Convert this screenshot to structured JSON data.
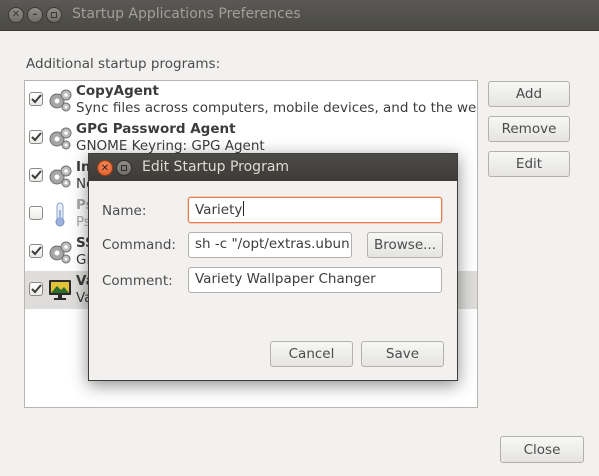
{
  "window": {
    "title": "Startup Applications Preferences",
    "section_label": "Additional startup programs:"
  },
  "programs": [
    {
      "name": "CopyAgent",
      "description": "Sync files across computers, mobile devices, and to the web",
      "checked": true,
      "icon": "gears-icon"
    },
    {
      "name": "GPG Password Agent",
      "description": "GNOME Keyring: GPG Agent",
      "checked": true,
      "icon": "gears-icon"
    },
    {
      "name": "In",
      "description": "No",
      "checked": true,
      "icon": "gears-icon"
    },
    {
      "name": "Ps",
      "description": "Ps",
      "checked": false,
      "icon": "thermometer-icon"
    },
    {
      "name": "SS",
      "description": "GN",
      "checked": true,
      "icon": "gears-icon"
    },
    {
      "name": "Va",
      "description": "Va",
      "checked": true,
      "icon": "monitor-icon"
    }
  ],
  "side_buttons": {
    "add": "Add",
    "remove": "Remove",
    "edit": "Edit"
  },
  "close_button": "Close",
  "dialog": {
    "title": "Edit Startup Program",
    "name_label": "Name:",
    "name_value": "Variety",
    "command_label": "Command:",
    "command_value": "sh -c \"/opt/extras.ubun",
    "browse_label": "Browse...",
    "comment_label": "Comment:",
    "comment_value": "Variety Wallpaper Changer",
    "cancel_label": "Cancel",
    "save_label": "Save"
  },
  "colors": {
    "focus_accent": "#e97a48",
    "close_button": "#e05a26",
    "titlebar": "#4a4944"
  }
}
